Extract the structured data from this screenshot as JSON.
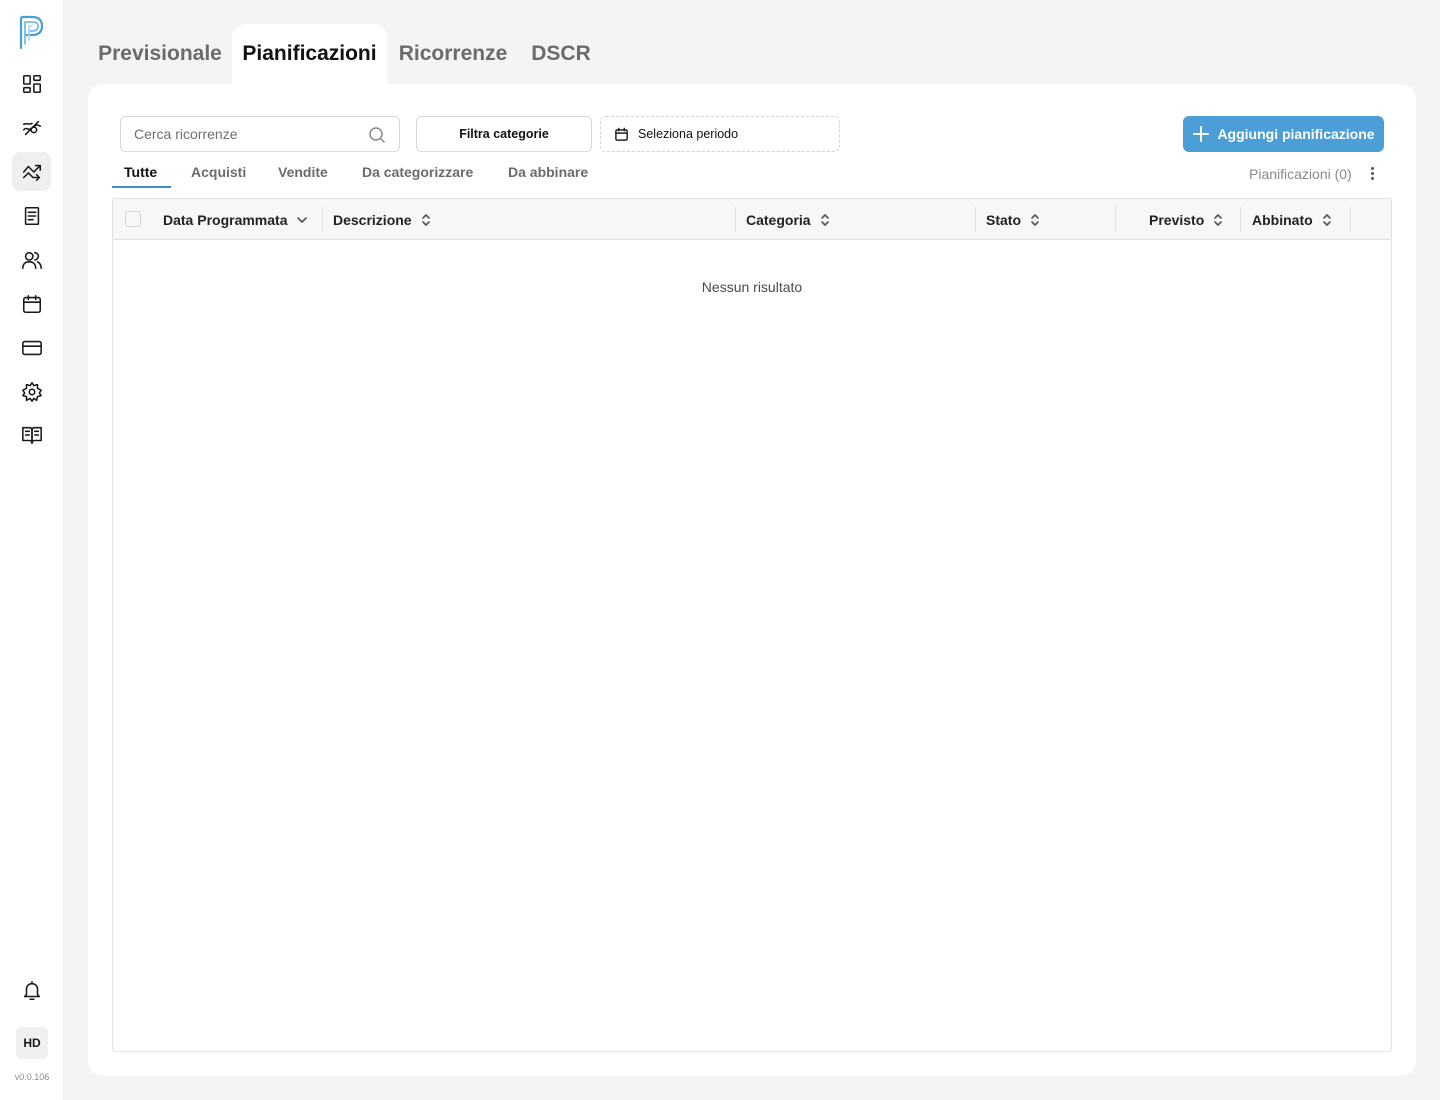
{
  "app": {
    "version": "v0.0.106",
    "avatar_initials": "HD"
  },
  "sidebar": {
    "items": [
      {
        "icon": "dashboard-icon"
      },
      {
        "icon": "cash-flow-icon"
      },
      {
        "icon": "trending-icon",
        "active": true
      },
      {
        "icon": "receipt-icon"
      },
      {
        "icon": "users-icon"
      },
      {
        "icon": "calendar-icon"
      },
      {
        "icon": "credit-card-icon"
      },
      {
        "icon": "gear-icon"
      },
      {
        "icon": "book-icon"
      }
    ],
    "bottom": {
      "icon": "bell-icon"
    }
  },
  "top_tabs": [
    {
      "label": "Previsionale"
    },
    {
      "label": "Pianificazioni",
      "active": true
    },
    {
      "label": "Ricorrenze"
    },
    {
      "label": "DSCR"
    }
  ],
  "toolbar": {
    "search_placeholder": "Cerca ricorrenze",
    "filter_label": "Filtra categorie",
    "period_label": "Seleziona periodo",
    "add_label": "Aggiungi pianificazione"
  },
  "sub_tabs": [
    {
      "label": "Tutte",
      "active": true
    },
    {
      "label": "Acquisti"
    },
    {
      "label": "Vendite"
    },
    {
      "label": "Da categorizzare"
    },
    {
      "label": "Da abbinare"
    }
  ],
  "count_label": "Pianificazioni (0)",
  "table": {
    "columns": [
      {
        "label": "Data Programmata",
        "sort": "desc"
      },
      {
        "label": "Descrizione",
        "sort": "none"
      },
      {
        "label": "Categoria",
        "sort": "none"
      },
      {
        "label": "Stato",
        "sort": "none"
      },
      {
        "label": "Previsto",
        "sort": "none"
      },
      {
        "label": "Abbinato",
        "sort": "none"
      }
    ],
    "empty_text": "Nessun risultato"
  },
  "colors": {
    "accent": "#4b9fd6",
    "tab_underline": "#3c8fd0",
    "background": "#f4f4f4"
  }
}
